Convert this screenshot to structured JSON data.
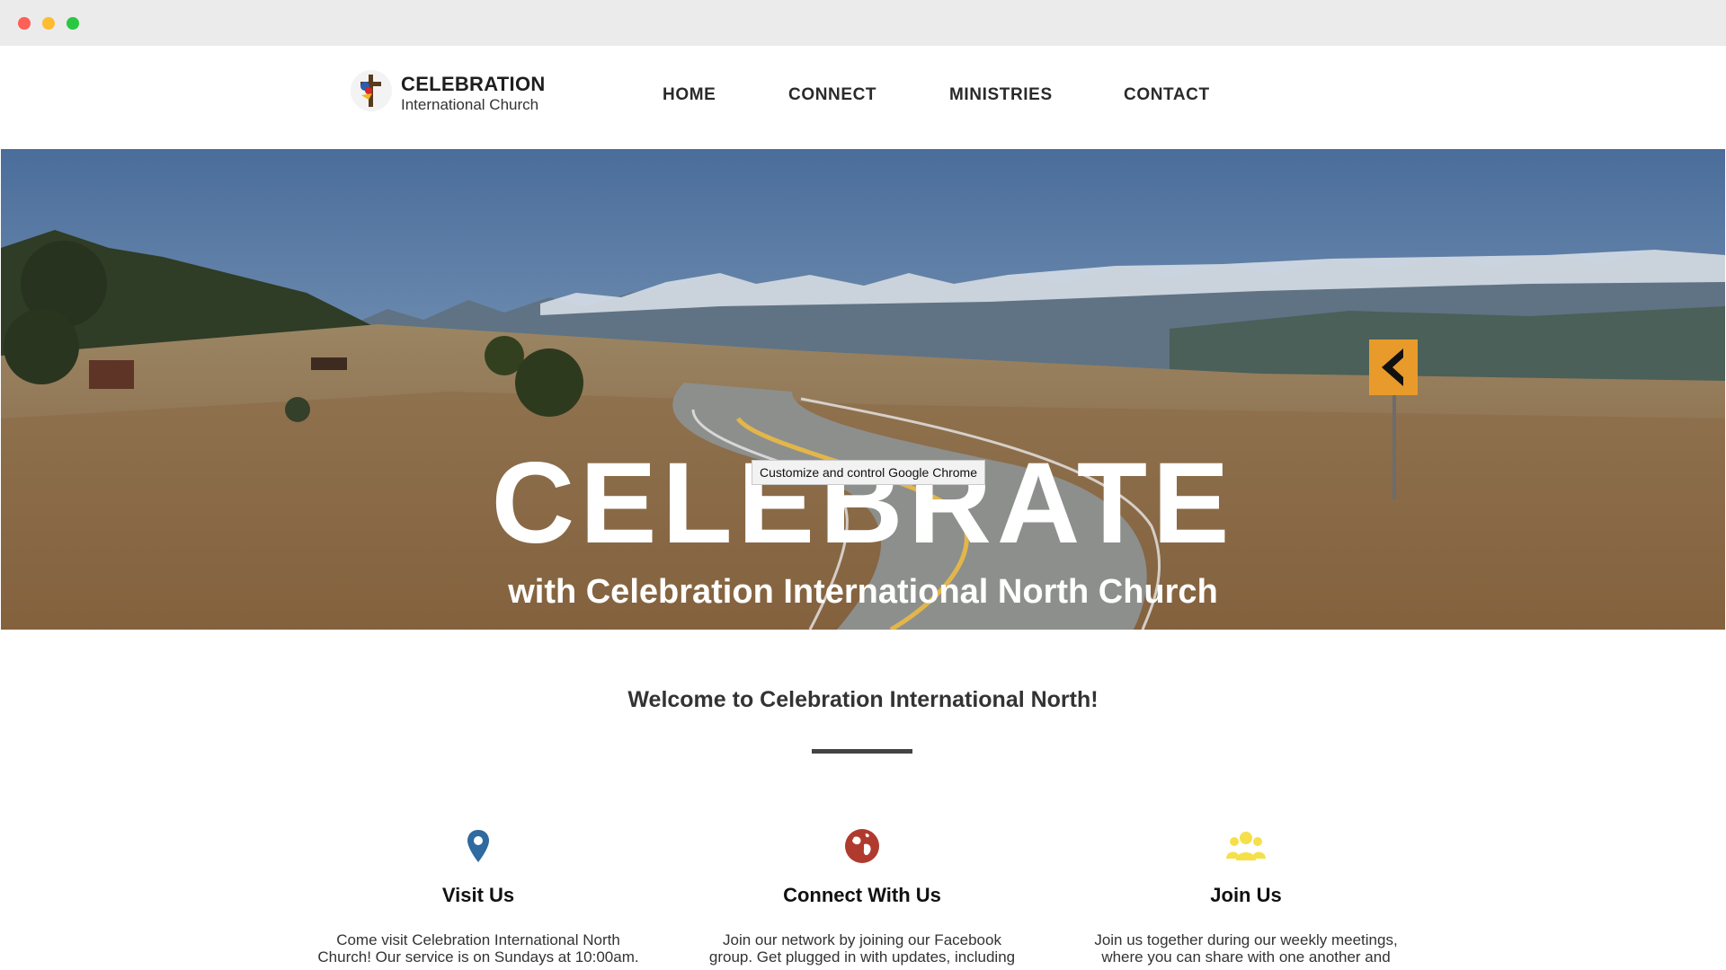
{
  "header": {
    "logo_title": "CELEBRATION",
    "logo_subtitle": "International Church",
    "nav": [
      "HOME",
      "CONNECT",
      "MINISTRIES",
      "CONTACT"
    ]
  },
  "hero": {
    "title": "CELEBRATE",
    "subtitle": "with Celebration International North Church",
    "tooltip": "Customize and control Google Chrome"
  },
  "welcome": {
    "heading": "Welcome to Celebration International North!"
  },
  "features": [
    {
      "icon": "map-pin-icon",
      "color": "#2f6aa0",
      "title": "Visit Us",
      "line1": "Come visit Celebration International North",
      "line2": "Church! Our service is on Sundays at 10:00am."
    },
    {
      "icon": "globe-icon",
      "color": "#b03a2e",
      "title": "Connect With Us",
      "line1": "Join our network by joining our Facebook",
      "line2": "group. Get plugged in with updates, including"
    },
    {
      "icon": "group-icon",
      "color": "#f5e04a",
      "title": "Join Us",
      "line1": "Join us together during our weekly meetings,",
      "line2": "where you can share with one another and"
    }
  ]
}
